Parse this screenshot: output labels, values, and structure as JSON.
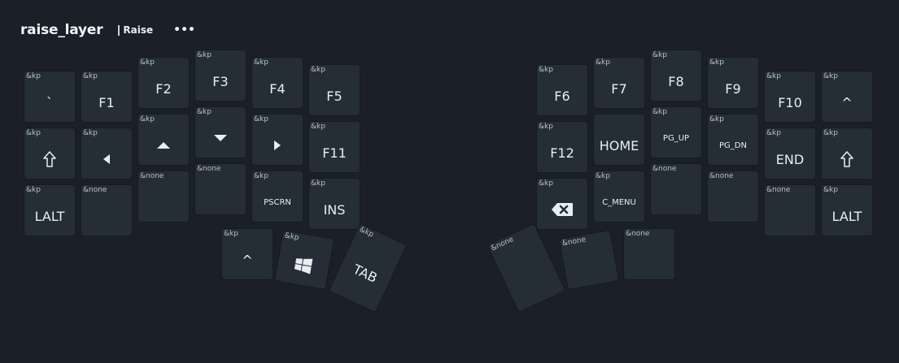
{
  "layer": {
    "name": "raise_layer",
    "label": "Raise",
    "more": "•••"
  },
  "keys": [
    {
      "id": "l00",
      "beh": "&kp",
      "lbl": "`"
    },
    {
      "id": "l01",
      "beh": "&kp",
      "lbl": "F1"
    },
    {
      "id": "l02",
      "beh": "&kp",
      "lbl": "F2"
    },
    {
      "id": "l03",
      "beh": "&kp",
      "lbl": "F3"
    },
    {
      "id": "l04",
      "beh": "&kp",
      "lbl": "F4"
    },
    {
      "id": "l05",
      "beh": "&kp",
      "lbl": "F5"
    },
    {
      "id": "l10",
      "beh": "&kp",
      "icon": "shift-icon"
    },
    {
      "id": "l11",
      "beh": "&kp",
      "icon": "arrow-left-icon"
    },
    {
      "id": "l12",
      "beh": "&kp",
      "icon": "arrow-up-icon"
    },
    {
      "id": "l13",
      "beh": "&kp",
      "icon": "arrow-down-icon"
    },
    {
      "id": "l14",
      "beh": "&kp",
      "icon": "arrow-right-icon"
    },
    {
      "id": "l15",
      "beh": "&kp",
      "lbl": "F11"
    },
    {
      "id": "l20",
      "beh": "&kp",
      "lbl": "LALT"
    },
    {
      "id": "l21",
      "beh": "&none",
      "lbl": ""
    },
    {
      "id": "l22",
      "beh": "&none",
      "lbl": ""
    },
    {
      "id": "l23",
      "beh": "&none",
      "lbl": ""
    },
    {
      "id": "l24",
      "beh": "&kp",
      "lbl": "PSCRN",
      "small": true
    },
    {
      "id": "l25",
      "beh": "&kp",
      "lbl": "INS"
    },
    {
      "id": "lt0",
      "beh": "&kp",
      "lbl": "^"
    },
    {
      "id": "lt1",
      "beh": "&kp",
      "icon": "windows-icon"
    },
    {
      "id": "lt2",
      "beh": "&kp",
      "lbl": "TAB"
    },
    {
      "id": "r00",
      "beh": "&kp",
      "lbl": "F6"
    },
    {
      "id": "r01",
      "beh": "&kp",
      "lbl": "F7"
    },
    {
      "id": "r02",
      "beh": "&kp",
      "lbl": "F8"
    },
    {
      "id": "r03",
      "beh": "&kp",
      "lbl": "F9"
    },
    {
      "id": "r04",
      "beh": "&kp",
      "lbl": "F10"
    },
    {
      "id": "r05",
      "beh": "&kp",
      "lbl": "^"
    },
    {
      "id": "r10",
      "beh": "&kp",
      "lbl": "F12"
    },
    {
      "id": "r11",
      "beh": "",
      "lbl": "HOME"
    },
    {
      "id": "r12",
      "beh": "&kp",
      "lbl": "PG_UP",
      "small": true
    },
    {
      "id": "r13",
      "beh": "&kp",
      "lbl": "PG_DN",
      "small": true
    },
    {
      "id": "r14",
      "beh": "&kp",
      "lbl": "END"
    },
    {
      "id": "r15",
      "beh": "&kp",
      "icon": "shift-icon"
    },
    {
      "id": "r20",
      "beh": "&kp",
      "icon": "backspace-icon"
    },
    {
      "id": "r21",
      "beh": "&kp",
      "lbl": "C_MENU",
      "small": true
    },
    {
      "id": "r22",
      "beh": "&none",
      "lbl": ""
    },
    {
      "id": "r23",
      "beh": "&none",
      "lbl": ""
    },
    {
      "id": "r24",
      "beh": "&none",
      "lbl": ""
    },
    {
      "id": "r25",
      "beh": "&kp",
      "lbl": "LALT"
    },
    {
      "id": "rt0",
      "beh": "&none",
      "lbl": ""
    },
    {
      "id": "rt1",
      "beh": "&none",
      "lbl": ""
    },
    {
      "id": "rt2",
      "beh": "&none",
      "lbl": ""
    }
  ]
}
